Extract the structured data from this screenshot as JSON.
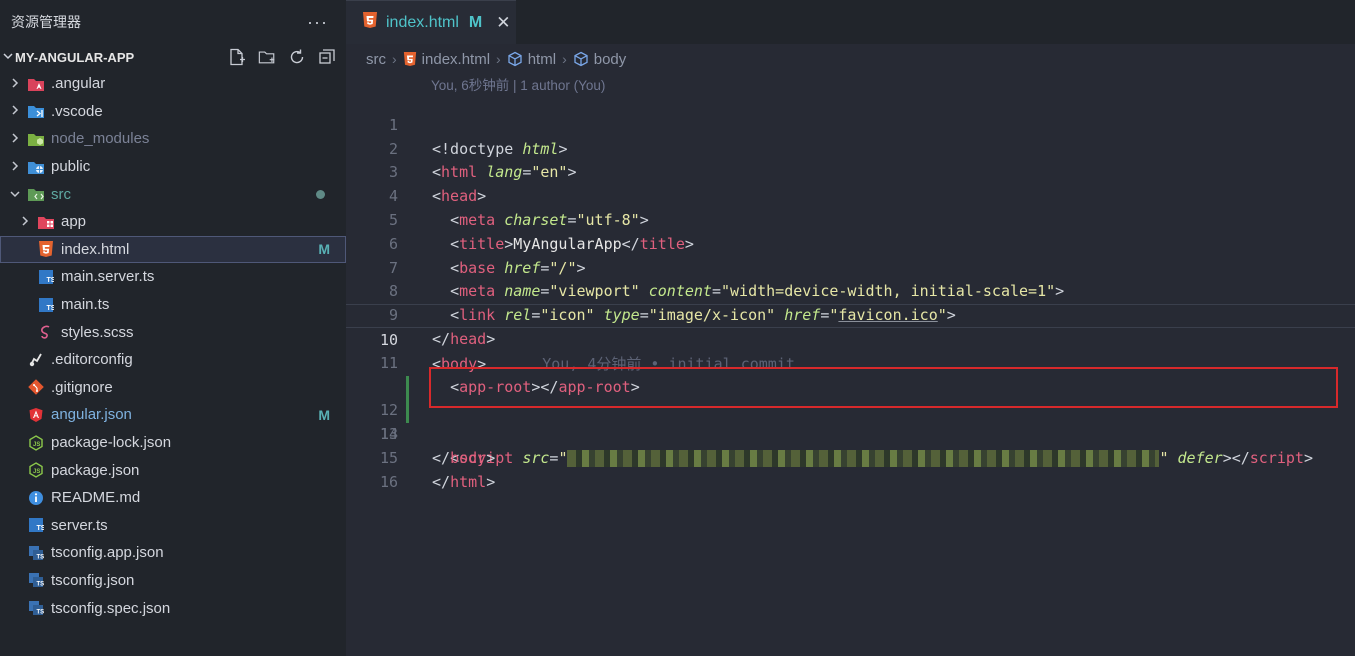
{
  "sidebar": {
    "title": "资源管理器",
    "more": "···",
    "project": "MY-ANGULAR-APP",
    "items": [
      {
        "label": ".angular",
        "badge": ""
      },
      {
        "label": ".vscode",
        "badge": ""
      },
      {
        "label": "node_modules",
        "badge": ""
      },
      {
        "label": "public",
        "badge": ""
      },
      {
        "label": "src",
        "badge": ""
      },
      {
        "label": "app",
        "badge": ""
      },
      {
        "label": "index.html",
        "badge": "M"
      },
      {
        "label": "main.server.ts",
        "badge": ""
      },
      {
        "label": "main.ts",
        "badge": ""
      },
      {
        "label": "styles.scss",
        "badge": ""
      },
      {
        "label": ".editorconfig",
        "badge": ""
      },
      {
        "label": ".gitignore",
        "badge": ""
      },
      {
        "label": "angular.json",
        "badge": "M"
      },
      {
        "label": "package-lock.json",
        "badge": ""
      },
      {
        "label": "package.json",
        "badge": ""
      },
      {
        "label": "README.md",
        "badge": ""
      },
      {
        "label": "server.ts",
        "badge": ""
      },
      {
        "label": "tsconfig.app.json",
        "badge": ""
      },
      {
        "label": "tsconfig.json",
        "badge": ""
      },
      {
        "label": "tsconfig.spec.json",
        "badge": ""
      }
    ]
  },
  "editor": {
    "tab": {
      "label": "index.html",
      "badge": "M",
      "close": "✕"
    },
    "breadcrumb": [
      "src",
      "index.html",
      "html",
      "body"
    ],
    "blame_header": "You, 6秒钟前 | 1 author (You)",
    "inline_blame": "You, 4分钟前 • initial commit",
    "line_numbers": [
      "1",
      "2",
      "3",
      "4",
      "5",
      "6",
      "7",
      "8",
      "9",
      "10",
      "11",
      "12",
      "13",
      "14",
      "15",
      "16"
    ],
    "code": {
      "l1_doctype": "!doctype",
      "l1_html": "html",
      "l2_tag": "html",
      "l2_attr": "lang",
      "l2_val": "\"en\"",
      "l3_tag": "head",
      "l4_tag": "meta",
      "l4_attr": "charset",
      "l4_val": "\"utf-8\"",
      "l5_tag": "title",
      "l5_text": "MyAngularApp",
      "l6_tag": "base",
      "l6_attr": "href",
      "l6_val": "\"/\"",
      "l7_tag": "meta",
      "l7_attr1": "name",
      "l7_val1": "\"viewport\"",
      "l7_attr2": "content",
      "l7_val2": "\"width=device-width, initial-scale=1\"",
      "l8_tag": "link",
      "l8_attr1": "rel",
      "l8_val1": "\"icon\"",
      "l8_attr2": "type",
      "l8_val2": "\"image/x-icon\"",
      "l8_attr3": "href",
      "l8_val3": "favicon.ico",
      "l9_tag": "head",
      "l10_tag": "body",
      "l11_tag": "app-root",
      "l13_tag": "script",
      "l13_attr1": "src",
      "l13_attr2": "defer",
      "l14_tag": "body",
      "l15_tag": "html"
    }
  }
}
